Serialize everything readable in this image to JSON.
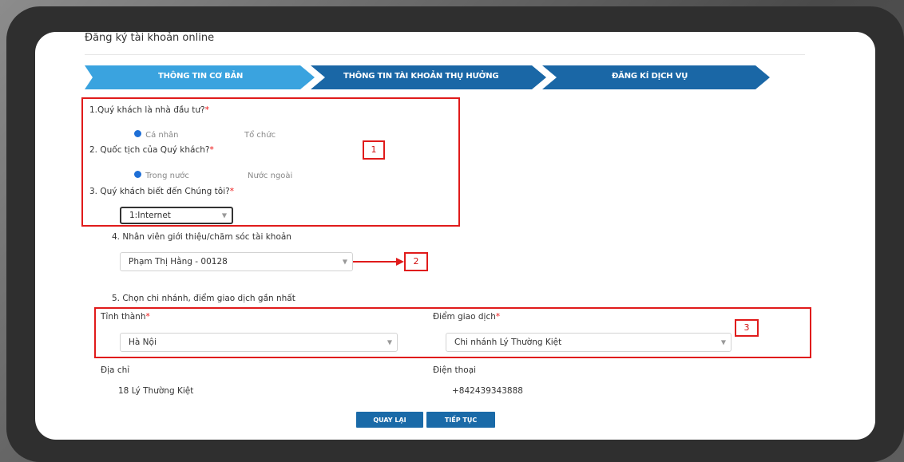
{
  "header": {
    "title": "Đăng ký tài khoản online"
  },
  "steps": [
    {
      "label": "THÔNG TIN CƠ BẢN",
      "active": true
    },
    {
      "label": "THÔNG TIN TÀI KHOẢN THỤ HƯỞNG",
      "active": false
    },
    {
      "label": "ĐĂNG KÍ DỊCH VỤ",
      "active": false
    }
  ],
  "colors": {
    "step_active": "#3aa3df",
    "step_inactive": "#1a67a6",
    "highlight": "#e01b1b",
    "button": "#1a6aa8"
  },
  "q1": {
    "label": "1.Quý khách là nhà đầu tư?",
    "required": "*",
    "options": [
      {
        "label": "Cá nhân",
        "selected": true
      },
      {
        "label": "Tổ chức",
        "selected": false
      }
    ]
  },
  "q2": {
    "label": "2. Quốc tịch của Quý khách?",
    "required": "*",
    "options": [
      {
        "label": "Trong nước",
        "selected": true
      },
      {
        "label": "Nước ngoài",
        "selected": false
      }
    ]
  },
  "q3": {
    "label": "3. Quý khách biết đến Chúng tôi?",
    "required": "*",
    "value": "1:Internet"
  },
  "q4": {
    "label": "4. Nhân viên giới thiệu/chăm sóc tài khoản",
    "value": "Phạm Thị Hằng - 00128"
  },
  "q5": {
    "label": "5. Chọn chi nhánh, điểm giao dịch gần nhất",
    "province_label": "Tỉnh thành",
    "province_required": "*",
    "province_value": "Hà Nội",
    "branch_label": "Điểm giao dịch",
    "branch_required": "*",
    "branch_value": "Chi nhánh Lý Thường Kiệt",
    "address_label": "Địa chỉ",
    "address_value": "18 Lý Thường Kiệt",
    "phone_label": "Điện thoại",
    "phone_value": "+842439343888"
  },
  "annotations": {
    "box1": "1",
    "box2": "2",
    "box3": "3"
  },
  "buttons": {
    "back": "QUAY LẠI",
    "next": "TIẾP TỤC"
  },
  "icons": {
    "select_arrow": "chevron-down-icon",
    "pointer": "red-arrow-icon"
  }
}
